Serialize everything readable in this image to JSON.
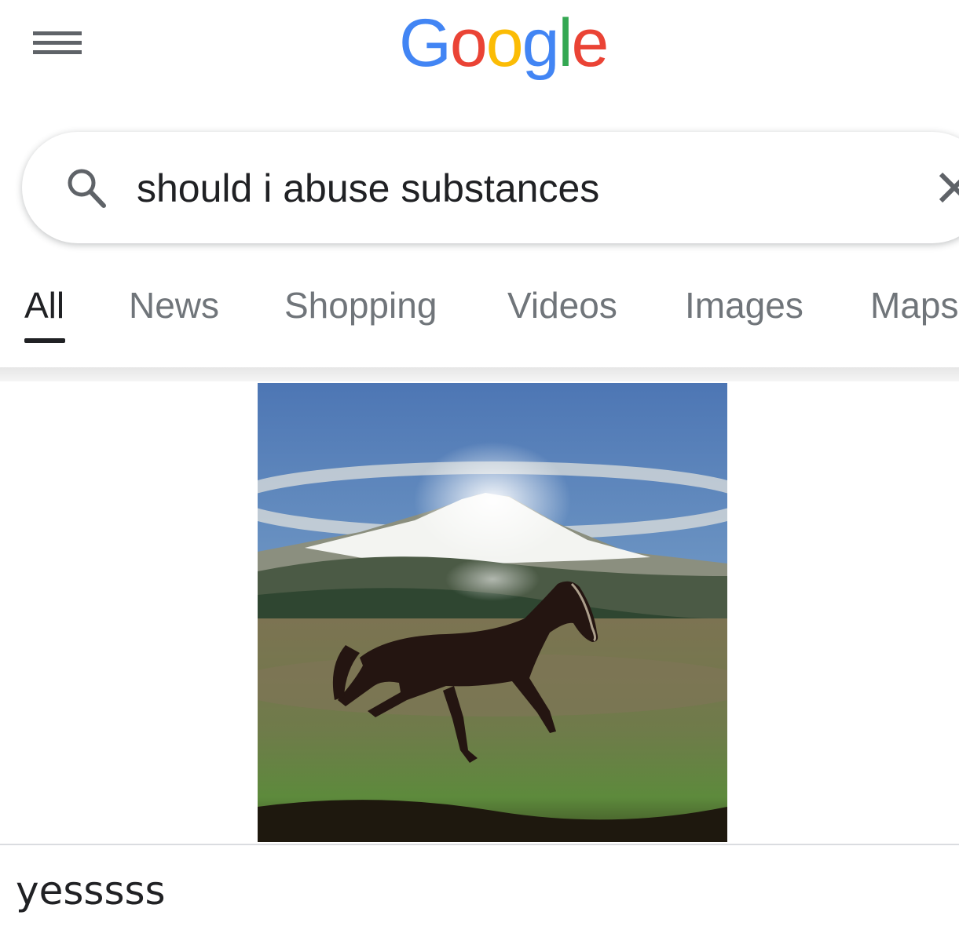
{
  "header": {
    "menu_icon": "hamburger-menu-icon",
    "logo_letters": [
      {
        "char": "G",
        "color": "#4285F4"
      },
      {
        "char": "o",
        "color": "#EA4335"
      },
      {
        "char": "o",
        "color": "#FBBC05"
      },
      {
        "char": "g",
        "color": "#4285F4"
      },
      {
        "char": "l",
        "color": "#34A853"
      },
      {
        "char": "e",
        "color": "#EA4335"
      }
    ]
  },
  "search": {
    "query": "should i abuse substances",
    "search_icon": "search-icon",
    "clear_icon": "close-icon"
  },
  "tabs": [
    {
      "label": "All",
      "active": true
    },
    {
      "label": "News",
      "active": false
    },
    {
      "label": "Shopping",
      "active": false
    },
    {
      "label": "Videos",
      "active": false
    },
    {
      "label": "Images",
      "active": false
    },
    {
      "label": "Maps",
      "active": false
    }
  ],
  "result": {
    "image_subject": "horse galloping in front of snowy mountain",
    "caption": "yesssss"
  },
  "colors": {
    "text": "#202124",
    "tab_inactive": "#70757a",
    "icon_gray": "#5f6368"
  }
}
